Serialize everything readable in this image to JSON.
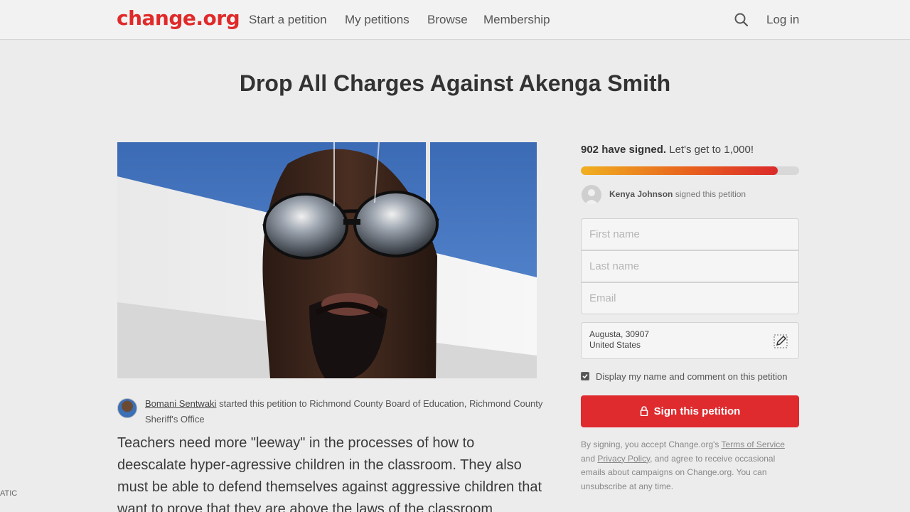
{
  "header": {
    "logo": "change.org",
    "nav": [
      "Start a petition",
      "My petitions",
      "Browse",
      "Membership"
    ],
    "login": "Log in"
  },
  "petition": {
    "title": "Drop All Charges Against Akenga Smith",
    "starter_name": "Bomani Sentwaki",
    "starter_text": " started this petition to Richmond County Board of Education, Richmond County Sheriff's Office",
    "body": "Teachers need more \"leeway\" in the processes of how to deescalate hyper-agressive children in the classroom. They also must be able to defend themselves against aggressive children that want to prove that they are above the laws of the classroom"
  },
  "panel": {
    "signed_count": "902 have signed.",
    "goal_text": " Let's get to 1,000!",
    "progress": 0.902,
    "recent_name": "Kenya Johnson",
    "recent_action": " signed this petition",
    "first_name_placeholder": "First name",
    "last_name_placeholder": "Last name",
    "email_placeholder": "Email",
    "location_line1": "Augusta, 30907",
    "location_line2": "United States",
    "display_checkbox_label": "Display my name and comment on this petition",
    "display_checked": true,
    "sign_button": "Sign this petition",
    "disclaimer_1": "By signing, you accept Change.org's ",
    "disclaimer_terms": "Terms of Service",
    "disclaimer_2": " and ",
    "disclaimer_privacy": "Privacy Policy",
    "disclaimer_3": ", and agree to receive occasional emails about campaigns on Change.org. You can unsubscribe at any time."
  },
  "overlay": {
    "corner_text": "ATIC"
  },
  "colors": {
    "brand": "#e02a2a",
    "sign_button": "#df2a2e",
    "page_bg": "#ececec"
  },
  "icons": {
    "search": "search-icon",
    "edit": "edit-pencil-icon",
    "lock": "lock-icon"
  }
}
